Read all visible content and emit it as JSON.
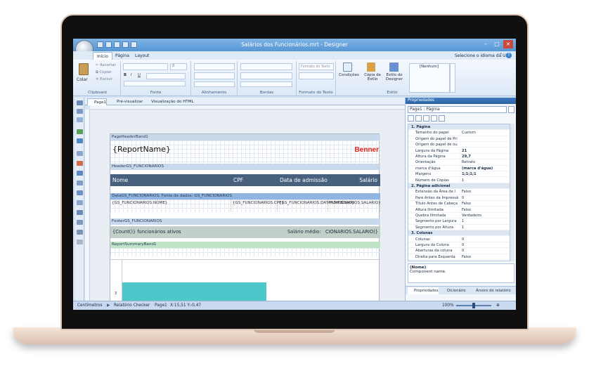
{
  "window": {
    "title": "Salários dos Funcionários.mrt - Designer"
  },
  "menu": {
    "tabs": [
      "Início",
      "Página",
      "Layout"
    ],
    "right_link": "Selecione o idioma da UI"
  },
  "ribbon": {
    "clipboard": {
      "paste": "Colar",
      "cut": "Recortar",
      "copy": "Copiar",
      "delete": "Excluir",
      "label": "Clipboard"
    },
    "font": {
      "label": "Fonte",
      "size": "8"
    },
    "alignment": {
      "label": "Alinhamento"
    },
    "borders": {
      "label": "Bordas"
    },
    "text_format": {
      "label": "Formato do Texto",
      "value": "Formato do Texto"
    },
    "style": {
      "conditions": "Condições",
      "copy_style": "Cópia de Estilo",
      "designer_style": "Estilo do Designer",
      "none": "[Nenhum]",
      "label": "Estilo"
    }
  },
  "doc_tabs": [
    "Page1",
    "Pré-visualizar",
    "Visualização do HTML"
  ],
  "report": {
    "page_header_band": "PageHeaderBand1",
    "report_name": "{ReportName}",
    "logo_text": "Benner",
    "header_band": "HeaderGS_FUNCIONARIOS",
    "columns": [
      "Nome",
      "CPF",
      "Data de admissão",
      "Salário"
    ],
    "data_band": "DataGS_FUNCIONARIOS; Fonte de dados: GS_FUNCIONARIOS",
    "data_cells": [
      "{GS_FUNCIONARIOS.NOME}",
      "{GS_FUNCIONARIOS.CPF}",
      "{GS_FUNCIONARIOS.DATAADMISSAO}",
      "FUNCIONARIOS.SALARIO}"
    ],
    "footer_band": "FooterGS_FUNCIONARIOS",
    "footer_count": "{Count()} funcionários ativos",
    "footer_avg_label": "Salário médio:",
    "footer_avg_value": "CIONARIOS.SALARIO)}",
    "summary_band": "ReportSummaryBand1",
    "chart_axis_tick": "3"
  },
  "status": {
    "units": "Centímetros",
    "checker": "Relatório Checker",
    "page": "Page1",
    "coords": "X:15,51 Y:-0,47",
    "zoom": "100%"
  },
  "properties": {
    "title": "Propriedades",
    "selected": "Page1 : Página",
    "rows": [
      {
        "cat": true,
        "name": "1. Página"
      },
      {
        "name": "Tamanho do papel",
        "value": "Custom"
      },
      {
        "name": "Origem do papel de Pri",
        "value": ""
      },
      {
        "name": "Origem do papel de ou",
        "value": ""
      },
      {
        "name": "Largura da Página",
        "value": "21"
      },
      {
        "name": "Altura da Página",
        "value": "29,7"
      },
      {
        "name": "Orientação",
        "value": "Retrato"
      },
      {
        "name": "marca d'água",
        "value": "(marca d'água)"
      },
      {
        "name": "Margens",
        "value": "1;1;1;1"
      },
      {
        "name": "Número de Cópias",
        "value": "1"
      },
      {
        "cat": true,
        "name": "2. Página adicional"
      },
      {
        "name": "Extensão da Área de I",
        "value": "Falso"
      },
      {
        "name": "Pare Antes da Impressã",
        "value": "0"
      },
      {
        "name": "Título Antes de Cabeça",
        "value": "Falso"
      },
      {
        "name": "Altura Ilimitada",
        "value": "Falso"
      },
      {
        "name": "Quebra Ilimitada",
        "value": "Verdadeiro"
      },
      {
        "name": "Segmento por Largura",
        "value": "1"
      },
      {
        "name": "Segmento por Altura",
        "value": "1"
      },
      {
        "cat": true,
        "name": "3. Colunas"
      },
      {
        "name": "Colunas",
        "value": "0"
      },
      {
        "name": "Largura da Coluna",
        "value": "0"
      },
      {
        "name": "Aberturas da coluna",
        "value": "0"
      },
      {
        "name": "Direita para Esquerda",
        "value": "Falso"
      }
    ],
    "desc_title": "(Nome)",
    "desc_text": "Component name.",
    "bottom_tabs": [
      "Propriedades",
      "Dicionário",
      "Árvore de relatório"
    ]
  }
}
